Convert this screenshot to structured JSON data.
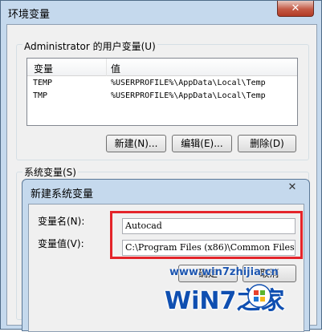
{
  "window": {
    "title": "环境变量",
    "close_glyph": "✕"
  },
  "user_vars": {
    "group_label": "Administrator 的用户变量(U)",
    "columns": [
      "变量",
      "值"
    ],
    "rows": [
      {
        "name": "TEMP",
        "value": "%USERPROFILE%\\AppData\\Local\\Temp"
      },
      {
        "name": "TMP",
        "value": "%USERPROFILE%\\AppData\\Local\\Temp"
      }
    ],
    "buttons": {
      "new": "新建(N)...",
      "edit": "编辑(E)...",
      "delete": "删除(D)"
    }
  },
  "system_vars": {
    "label": "系统变量(S)"
  },
  "dialog": {
    "title": "新建系统变量",
    "close_glyph": "✕",
    "name_label": "变量名(N):",
    "name_value": "Autocad",
    "value_label": "变量值(V):",
    "value_value": "C:\\Program Files (x86)\\Common Files",
    "ok_label": "确定",
    "cancel_label": "取消"
  },
  "watermark": {
    "url": "www.win7zhijia.cn",
    "brand": "WiN7之家"
  },
  "colors": {
    "highlight": "#e4242a",
    "title_bar": "#c5d9ed",
    "watermark": "#0f4fb1"
  }
}
